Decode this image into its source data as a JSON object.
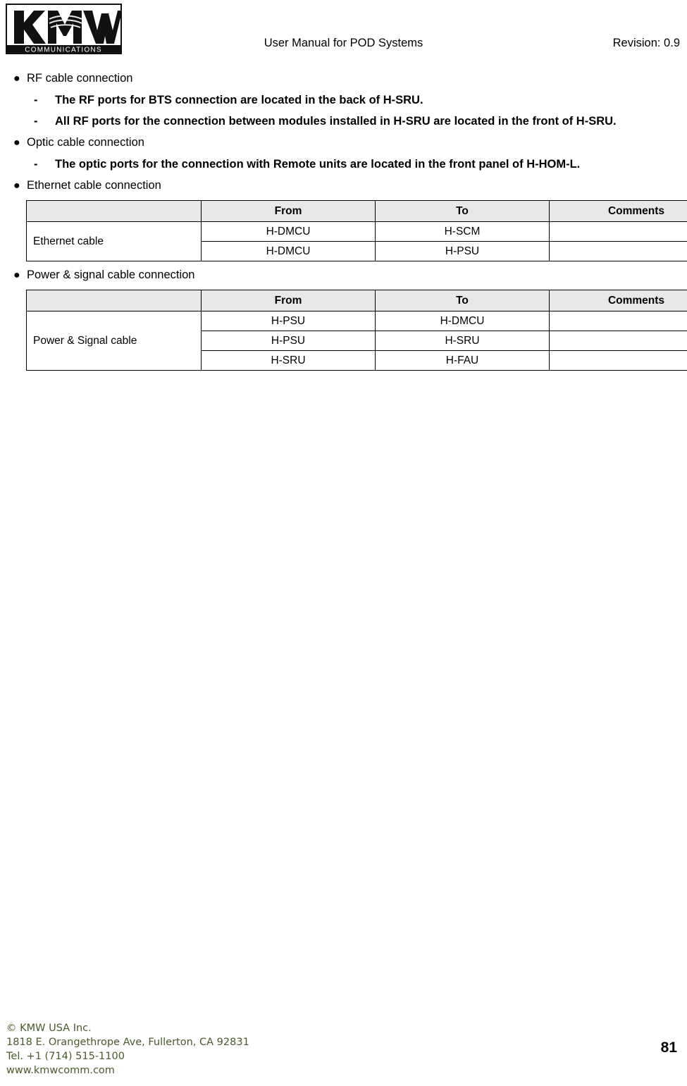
{
  "header": {
    "title": "User Manual for POD Systems",
    "revision": "Revision: 0.9",
    "logo": {
      "brand": "KMW",
      "subtitle": "COMMUNICATIONS"
    }
  },
  "content": {
    "sections": [
      {
        "bullet": "RF cable connection",
        "dashes": [
          "The RF ports for BTS connection are located in the back of H-SRU.",
          "All RF ports for the connection between modules installed in H-SRU are located in the front of H-SRU."
        ]
      },
      {
        "bullet": "Optic cable connection",
        "dashes": [
          "The optic ports for the connection with Remote units are located in the front panel of H-HOM-L."
        ]
      },
      {
        "bullet": "Ethernet cable connection",
        "dashes": []
      },
      {
        "bullet": "Power & signal cable connection",
        "dashes": []
      }
    ],
    "ethernet_table": {
      "headers": [
        "",
        "From",
        "To",
        "Comments"
      ],
      "row_label": "Ethernet cable",
      "rows": [
        {
          "from": "H-DMCU",
          "to": "H-SCM",
          "comments": ""
        },
        {
          "from": "H-DMCU",
          "to": "H-PSU",
          "comments": ""
        }
      ]
    },
    "power_table": {
      "headers": [
        "",
        "From",
        "To",
        "Comments"
      ],
      "row_label": "Power & Signal cable",
      "rows": [
        {
          "from": "H-PSU",
          "to": "H-DMCU",
          "comments": ""
        },
        {
          "from": "H-PSU",
          "to": "H-SRU",
          "comments": ""
        },
        {
          "from": "H-SRU",
          "to": "H-FAU",
          "comments": ""
        }
      ]
    }
  },
  "footer": {
    "line1": "© KMW USA Inc.",
    "line2": "1818 E. Orangethrope Ave, Fullerton, CA 92831",
    "line3": "Tel. +1 (714) 515-1100",
    "line4": "www.kmwcomm.com",
    "page_number": "81"
  }
}
